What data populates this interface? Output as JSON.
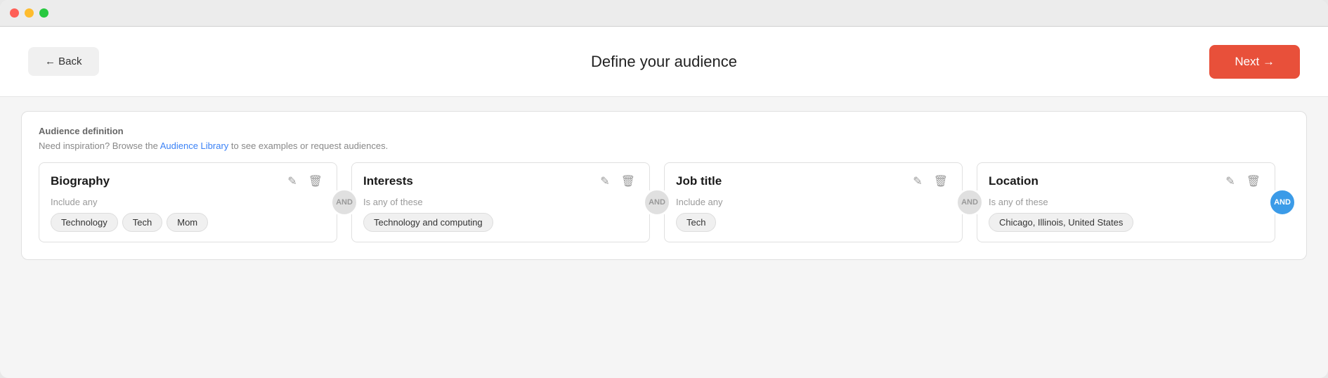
{
  "window": {
    "traffic_lights": [
      "close",
      "minimize",
      "maximize"
    ]
  },
  "header": {
    "back_label": "← Back",
    "title": "Define your audience",
    "next_label": "Next →"
  },
  "audience_section": {
    "label": "Audience definition",
    "subtitle_prefix": "Need inspiration? Browse the ",
    "subtitle_link": "Audience Library",
    "subtitle_suffix": " to see examples or request audiences."
  },
  "filters": [
    {
      "id": "biography",
      "title": "Biography",
      "condition": "Include any",
      "tags": [
        "Technology",
        "Tech",
        "Mom"
      ],
      "connector": "AND",
      "connector_active": false
    },
    {
      "id": "interests",
      "title": "Interests",
      "condition": "Is any of these",
      "tags": [
        "Technology and computing"
      ],
      "connector": "AND",
      "connector_active": false
    },
    {
      "id": "job-title",
      "title": "Job title",
      "condition": "Include any",
      "tags": [
        "Tech"
      ],
      "connector": "AND",
      "connector_active": false
    },
    {
      "id": "location",
      "title": "Location",
      "condition": "Is any of these",
      "tags": [
        "Chicago, Illinois, United States"
      ],
      "connector": "AND",
      "connector_active": true
    }
  ]
}
